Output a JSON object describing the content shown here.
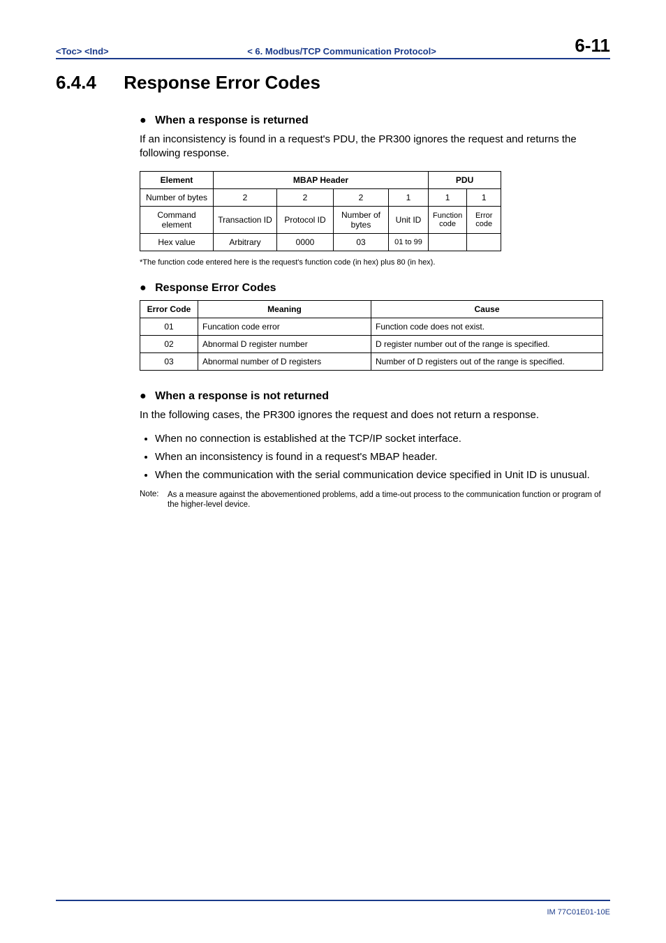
{
  "header": {
    "toc": "<Toc>",
    "ind": "<Ind>",
    "breadcrumb": "< 6.  Modbus/TCP Communication Protocol>",
    "page": "6-11"
  },
  "title": {
    "number": "6.4.4",
    "text": "Response Error Codes"
  },
  "sec1": {
    "heading": "When a response is returned",
    "body": "If an inconsistency is found in a request's PDU, the PR300 ignores the request and returns the following response.",
    "table": {
      "h_element": "Element",
      "h_mbap": "MBAP Header",
      "h_pdu": "PDU",
      "r_numbytes": "Number of bytes",
      "nb": [
        "2",
        "2",
        "2",
        "1",
        "1",
        "1"
      ],
      "r_cmd": "Command element",
      "cmd": [
        "Transaction ID",
        "Protocol ID",
        "Number of bytes",
        "Unit ID",
        "Function code",
        "Error code"
      ],
      "r_hex": "Hex value",
      "hex": [
        "Arbitrary",
        "0000",
        "03",
        "01 to 99",
        "",
        ""
      ]
    },
    "footnote": "*The function code entered here is the request's function code (in hex) plus 80 (in hex)."
  },
  "sec2": {
    "heading": "Response Error Codes",
    "th": [
      "Error Code",
      "Meaning",
      "Cause"
    ],
    "rows": [
      [
        "01",
        "Funcation code error",
        "Function code does not exist."
      ],
      [
        "02",
        "Abnormal D register number",
        "D register number out of the range is specified."
      ],
      [
        "03",
        "Abnormal number of D registers",
        "Number of D registers out of the range is specified."
      ]
    ]
  },
  "sec3": {
    "heading": "When a response is not returned",
    "body": "In the following cases, the PR300 ignores the request and does not return a response.",
    "bullets": [
      "When no connection is established at the TCP/IP socket interface.",
      "When an inconsistency is found in a request's MBAP header.",
      "When the communication with the serial communication device specified in Unit ID is unusual."
    ],
    "note_label": "Note:",
    "note_text": "As a measure against the abovementioned problems, add a time-out process to the communication function or program of the higher-level device."
  },
  "footer": {
    "id": "IM 77C01E01-10E"
  }
}
